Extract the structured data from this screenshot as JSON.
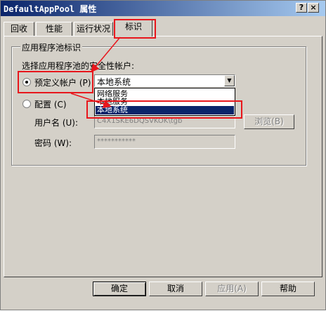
{
  "window": {
    "title": "DefaultAppPool 属性",
    "help_button": "?",
    "close_button": "×"
  },
  "tabs": [
    {
      "label": "回收"
    },
    {
      "label": "性能"
    },
    {
      "label": "运行状况"
    },
    {
      "label": "标识"
    }
  ],
  "identity": {
    "group_title": "应用程序池标识",
    "prompt": "选择应用程序池的安全性帐户:",
    "predefined_label": "预定义帐户 (P)",
    "predefined_selected": "本地系统",
    "dropdown_options": [
      "网络服务",
      "本地服务",
      "本地系统"
    ],
    "custom_label": "配置 (C)",
    "username_label": "用户名 (U):",
    "username_value": "C4X1SKE6DQSVKOK\\tgb",
    "password_label": "密码 (W):",
    "password_value": "***********",
    "browse_button": "浏览(B)"
  },
  "footer": {
    "ok_button": "确定",
    "cancel_button": "取消",
    "apply_button": "应用(A)",
    "help_button": "帮助"
  },
  "colors": {
    "titlebar_start": "#0a246a",
    "titlebar_end": "#a6caf0",
    "annotation": "#e8161c",
    "selection": "#0a246a"
  }
}
